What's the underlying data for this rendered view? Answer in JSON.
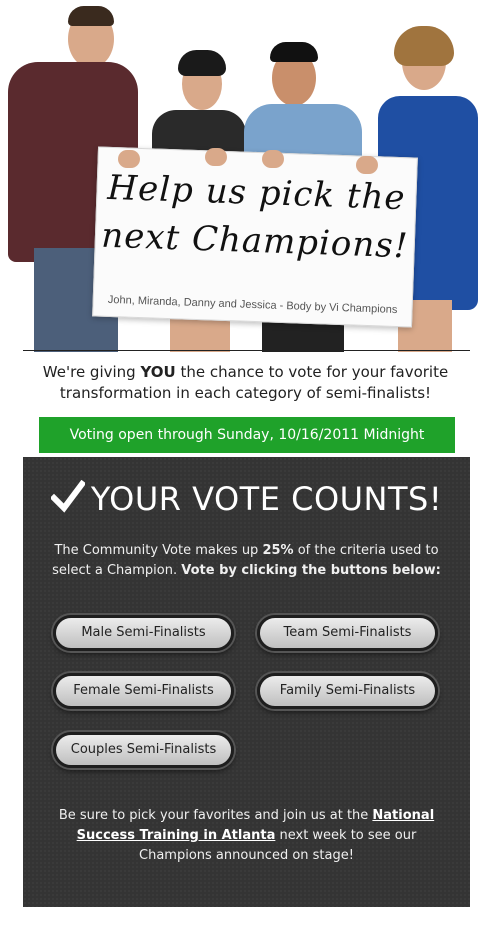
{
  "hero": {
    "sign_line1": "Help us pick the",
    "sign_line2": "next Champions!",
    "sign_caption": "John, Miranda, Danny and Jessica - Body by Vi Champions"
  },
  "intro": {
    "line1_pre": "We're giving ",
    "line1_bold": "YOU",
    "line1_post": " the chance to vote for your favorite",
    "line2": "transformation in each category of semi-finalists!"
  },
  "voting_bar": "Voting open through Sunday, 10/16/2011 Midnight",
  "panel": {
    "title": "YOUR VOTE COUNTS!",
    "text_pre": "The Community Vote makes up ",
    "text_bold_pct": "25%",
    "text_mid": " of the criteria used to select a Champion. ",
    "text_bold_cta": "Vote by clicking the buttons below:",
    "buttons": {
      "male": "Male Semi-Finalists",
      "team": "Team Semi-Finalists",
      "female": "Female Semi-Finalists",
      "family": "Family Semi-Finalists",
      "couples": "Couples Semi-Finalists"
    },
    "footer_pre": "Be sure to pick your favorites and join us at the ",
    "footer_link": "National Success Training in Atlanta",
    "footer_post": " next week to see our Champions announced on stage!"
  },
  "colors": {
    "voting_bar": "#1fa22a",
    "panel_bg": "#343434"
  }
}
